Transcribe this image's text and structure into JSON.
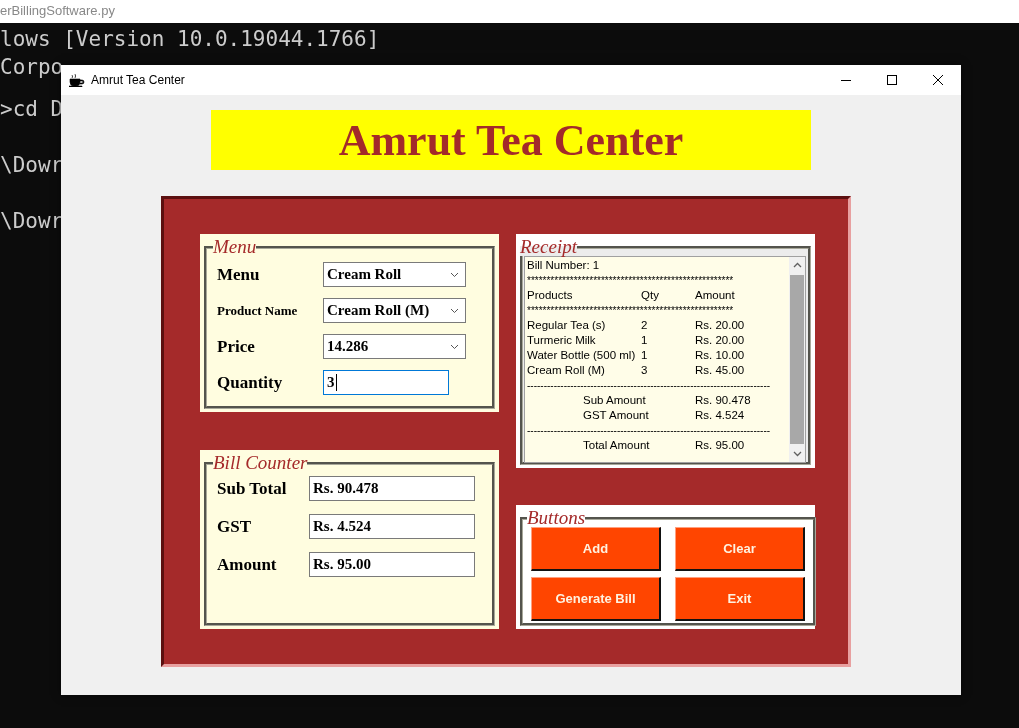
{
  "background": {
    "file_title": "erBillingSoftware.py",
    "terminal_lines": [
      "lows [Version 10.0.19044.1766]",
      "Corpo",
      ">cd D",
      "\\Dowr",
      "\\Dowr"
    ]
  },
  "window": {
    "title": "Amrut Tea Center"
  },
  "banner": "Amrut Tea Center",
  "menu_panel": {
    "title": "Menu",
    "fields": [
      {
        "label": "Menu",
        "kind": "dropdown",
        "value": "Cream Roll",
        "focused": false
      },
      {
        "label": "Product Name",
        "kind": "dropdown",
        "value": "Cream Roll (M)",
        "focused": false
      },
      {
        "label": "Price",
        "kind": "dropdown",
        "value": "14.286",
        "focused": false
      },
      {
        "label": "Quantity",
        "kind": "input",
        "value": "3",
        "focused": true
      }
    ]
  },
  "receipt": {
    "title": "Receipt",
    "lines": [
      {
        "kind": "text",
        "text": "Bill Number: 1"
      },
      {
        "kind": "rule",
        "text": "*****************************************************"
      },
      {
        "kind": "row",
        "cells": [
          "Products",
          "Qty",
          "Amount"
        ]
      },
      {
        "kind": "rule",
        "text": "*****************************************************"
      },
      {
        "kind": "row",
        "cells": [
          "Regular Tea (s)",
          "2",
          "Rs. 20.00"
        ]
      },
      {
        "kind": "row",
        "cells": [
          "Turmeric Milk",
          "1",
          "Rs. 20.00"
        ]
      },
      {
        "kind": "row",
        "cells": [
          "Water Bottle (500 ml)",
          "1",
          "Rs. 10.00"
        ]
      },
      {
        "kind": "row",
        "cells": [
          "Cream Roll (M)",
          "3",
          "Rs. 45.00"
        ]
      },
      {
        "kind": "rule",
        "text": "-------------------------------------------------------------------------"
      },
      {
        "kind": "total",
        "cells": [
          "Sub Amount",
          "Rs. 90.478"
        ]
      },
      {
        "kind": "total",
        "cells": [
          "GST Amount",
          "Rs. 4.524"
        ]
      },
      {
        "kind": "rule",
        "text": "-------------------------------------------------------------------------"
      },
      {
        "kind": "total",
        "cells": [
          "Total Amount",
          "Rs. 95.00"
        ]
      }
    ]
  },
  "bill_counter": {
    "title": "Bill Counter",
    "fields": [
      {
        "label": "Sub Total",
        "value": "Rs. 90.478"
      },
      {
        "label": "GST",
        "value": "Rs. 4.524"
      },
      {
        "label": "Amount",
        "value": "Rs. 95.00"
      }
    ]
  },
  "buttons_panel": {
    "title": "Buttons",
    "buttons": [
      "Add",
      "Clear",
      "Generate Bill",
      "Exit"
    ]
  }
}
